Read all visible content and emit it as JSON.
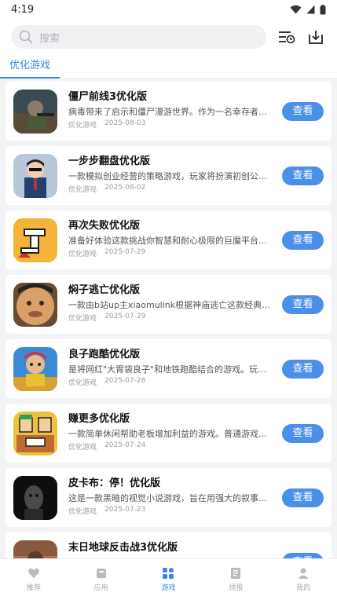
{
  "status_bar": {
    "time": "4:19"
  },
  "search": {
    "placeholder": "搜索"
  },
  "tabs": [
    {
      "label": "优化游戏",
      "active": true
    }
  ],
  "colors": {
    "accent": "#3a86e8",
    "button": "#4a90e9"
  },
  "games": [
    {
      "title": "僵尸前线3优化版",
      "desc": "病毒带来了启示和僵尸漫游世界。作为一名幸存者…",
      "category": "优化游戏",
      "date": "2025-08-03",
      "button": "查看",
      "icon": "zombie-frontline-icon"
    },
    {
      "title": "一步步翻盘优化版",
      "desc": "一款模拟创业经营的策略游戏，玩家将扮演初创公…",
      "category": "优化游戏",
      "date": "2025-08-02",
      "button": "查看",
      "icon": "comeback-game-icon"
    },
    {
      "title": "再次失败优化版",
      "desc": "准备好体验这款挑战你智慧和耐心极限的巨魔平台…",
      "category": "优化游戏",
      "date": "2025-07-29",
      "button": "查看",
      "icon": "fail-again-icon"
    },
    {
      "title": "焖子逃亡优化版",
      "desc": "一款由b站up主xiaomulink根据神庙逃亡这款经典…",
      "category": "优化游戏",
      "date": "2025-07-29",
      "button": "查看",
      "icon": "escape-game-icon"
    },
    {
      "title": "良子跑酷优化版",
      "desc": "是将网红\"大胃袋良子\"和地铁跑酷结合的游戏。玩…",
      "category": "优化游戏",
      "date": "2025-07-28",
      "button": "查看",
      "icon": "parkour-game-icon"
    },
    {
      "title": "赚更多优化版",
      "desc": "一款简单休闲帮助老板增加利益的游戏。普通游戏…",
      "category": "优化游戏",
      "date": "2025-07-24",
      "button": "查看",
      "icon": "earn-more-icon"
    },
    {
      "title": "皮卡布：停！优化版",
      "desc": "这是一款黑暗的视觉小说游戏，旨在用强大的叙事…",
      "category": "优化游戏",
      "date": "2025-07-23",
      "button": "查看",
      "icon": "peekaboo-game-icon"
    },
    {
      "title": "末日地球反击战3优化版",
      "desc": "",
      "category": "",
      "date": "",
      "button": "查看",
      "icon": "doomsday-game-icon"
    }
  ],
  "bottom_nav": [
    {
      "label": "推荐",
      "icon": "heart-icon",
      "active": false
    },
    {
      "label": "应用",
      "icon": "apps-icon",
      "active": false
    },
    {
      "label": "游戏",
      "icon": "games-grid-icon",
      "active": true
    },
    {
      "label": "线报",
      "icon": "news-icon",
      "active": false
    },
    {
      "label": "我的",
      "icon": "profile-icon",
      "active": false
    }
  ]
}
